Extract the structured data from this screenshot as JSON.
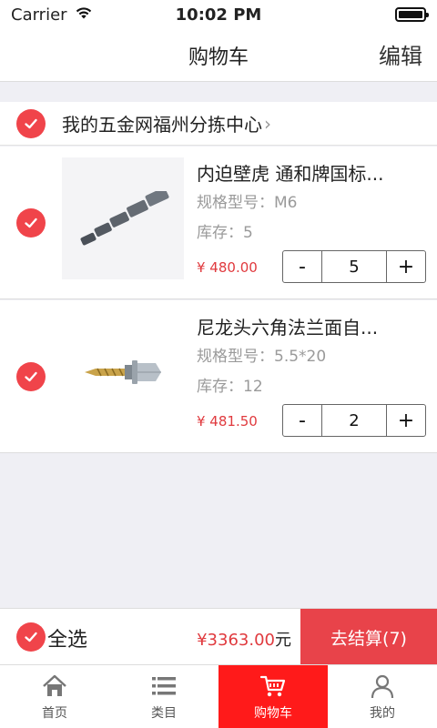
{
  "status_bar": {
    "carrier": "Carrier",
    "time": "10:02 PM"
  },
  "nav": {
    "title": "购物车",
    "edit": "编辑"
  },
  "store": {
    "name": "我的五金网福州分拣中心",
    "chevron": "›"
  },
  "items": [
    {
      "title": "内迫壁虎 通和牌国标...",
      "spec": "规格型号：M6",
      "stock": "库存：5",
      "price": "¥ 480.00",
      "qty": "5",
      "minus": "-",
      "plus": "+"
    },
    {
      "title": "尼龙头六角法兰面自...",
      "spec": "规格型号：5.5*20",
      "stock": "库存：12",
      "price": "¥ 481.50",
      "qty": "2",
      "minus": "-",
      "plus": "+"
    }
  ],
  "bottom": {
    "select_all": "全选",
    "total_amount": "¥3363.00",
    "total_unit": "元",
    "checkout": "去结算(7)"
  },
  "tabs": [
    {
      "label": "首页",
      "icon": "home-icon"
    },
    {
      "label": "类目",
      "icon": "list-icon"
    },
    {
      "label": "购物车",
      "icon": "cart-icon",
      "active": true
    },
    {
      "label": "我的",
      "icon": "user-icon"
    }
  ],
  "colors": {
    "accent": "#e8434a",
    "check": "#f0444a",
    "price": "#e03a3e",
    "tab_active": "#ff1a1a"
  }
}
